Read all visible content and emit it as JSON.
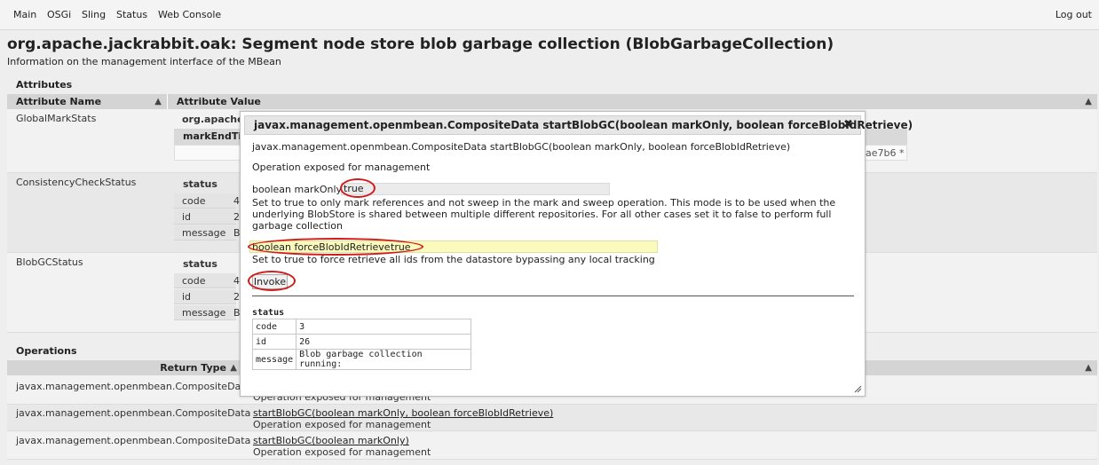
{
  "nav": {
    "items": [
      "Main",
      "OSGi",
      "Sling",
      "Status",
      "Web Console"
    ],
    "logout": "Log out"
  },
  "page": {
    "title": "org.apache.jackrabbit.oak: Segment node store blob garbage collection (BlobGarbageCollection)",
    "subtitle": "Information on the management interface of the MBean"
  },
  "attributes": {
    "section_title": "Attributes",
    "col_name": "Attribute Name",
    "col_value": "Attribute Value",
    "rows": [
      {
        "name": "GlobalMarkStats",
        "value_head": "org.apache",
        "sub_head": "markEndTi",
        "trailing": "ae7b6 *"
      },
      {
        "name": "ConsistencyCheckStatus",
        "status_label": "status",
        "keys": [
          "code",
          "id",
          "message"
        ],
        "vals": [
          "4",
          "2",
          "B"
        ]
      },
      {
        "name": "BlobGCStatus",
        "status_label": "status",
        "keys": [
          "code",
          "id",
          "message"
        ],
        "vals": [
          "4",
          "2",
          "B"
        ]
      }
    ]
  },
  "operations": {
    "section_title": "Operations",
    "col_return": "Return Type",
    "rows": [
      {
        "return_type": "javax.management.openmbean.CompositeData",
        "name": "",
        "desc": "Operation exposed for management"
      },
      {
        "return_type": "javax.management.openmbean.CompositeData",
        "name": "startBlobGC(boolean markOnly, boolean forceBlobIdRetrieve)",
        "desc": "Operation exposed for management"
      },
      {
        "return_type": "javax.management.openmbean.CompositeData",
        "name": "startBlobGC(boolean markOnly)",
        "desc": "Operation exposed for management"
      }
    ]
  },
  "dialog": {
    "title": "javax.management.openmbean.CompositeData startBlobGC(boolean markOnly, boolean forceBlobIdRetrieve)",
    "signature": "javax.management.openmbean.CompositeData startBlobGC(boolean markOnly, boolean forceBlobIdRetrieve)",
    "exposed": "Operation exposed for management",
    "param1_label": "boolean markOnly",
    "param1_value": "true",
    "param1_desc_1": "Set to true to only mark references and not sweep in the mark and sweep operation. This mode is to be used when the",
    "param1_desc_2": "underlying BlobStore is shared between multiple different repositories. For all other cases set it to false to perform full",
    "param1_desc_3": "garbage collection",
    "param2_label": "boolean forceBlobIdRetrieve",
    "param2_value": "true",
    "param2_desc": "Set to true to force retrieve all ids from the datastore bypassing any local tracking",
    "invoke_label": "Invoke",
    "result_title": "status",
    "result_rows": [
      {
        "key": "code",
        "value": "3"
      },
      {
        "key": "id",
        "value": "26"
      },
      {
        "key": "message",
        "value": "Blob garbage collection running:"
      }
    ]
  },
  "colors": {
    "annotation": "#d21c1c",
    "highlight_input": "#fafabc"
  }
}
